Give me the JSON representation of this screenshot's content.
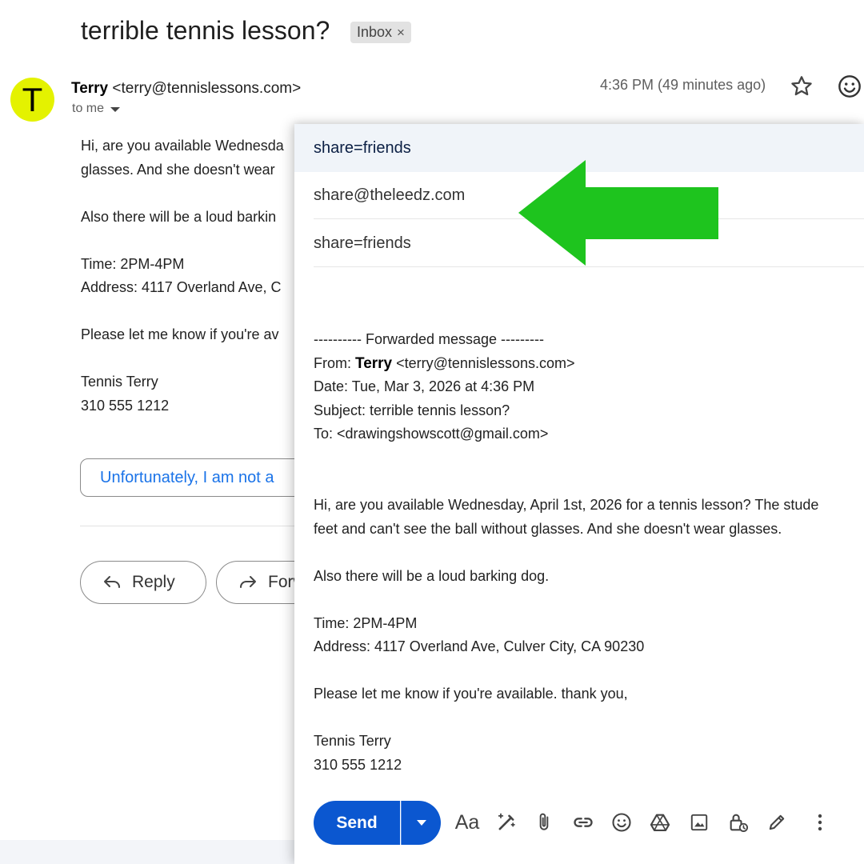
{
  "email": {
    "subject": "terrible tennis lesson?",
    "label_chip": "Inbox",
    "label_close": "×",
    "avatar_letter": "T",
    "sender_name": "Terry",
    "sender_email": "<terry@tennislessons.com>",
    "recipient": "to me",
    "timestamp": "4:36 PM (49 minutes ago)",
    "body_lines": [
      "Hi, are you available Wednesda",
      "glasses.  And she doesn't wear",
      "",
      "Also there will be a loud barkin",
      "",
      "Time: 2PM-4PM",
      "Address:  4117 Overland Ave, C",
      "",
      "Please let me know if you're av",
      "",
      "Tennis Terry",
      "310 555 1212"
    ],
    "smart_reply": "Unfortunately, I am not a",
    "reply_label": "Reply",
    "forward_label": "Forw"
  },
  "compose": {
    "header_title": "share=friends",
    "to_value": "share@theleedz.com",
    "subject_value": "share=friends",
    "forward_header": "---------- Forwarded message ---------",
    "from_label": "From: ",
    "from_name": "Terry",
    "from_email": " <terry@tennislessons.com>",
    "date_line": "Date: Tue, Mar 3, 2026 at 4:36 PM",
    "subject_line": "Subject: terrible tennis lesson?",
    "to_line": "To: <drawingshowscott@gmail.com>",
    "body_lines": [
      "Hi, are you available Wednesday, April 1st, 2026 for a tennis lesson? The stude",
      "feet and can't see the ball without glasses.  And she doesn't wear glasses.",
      "",
      "Also there will be a loud barking dog.",
      "",
      "Time: 2PM-4PM",
      "Address:  4117 Overland Ave, Culver City, CA 90230",
      "",
      "Please let me know if you're available.  thank you,",
      "",
      "Tennis Terry",
      "310 555 1212"
    ],
    "send_label": "Send",
    "format_label": "Aa"
  },
  "icons": {
    "star": "star-icon",
    "emoji": "smile-icon",
    "reply": "reply-arrow-icon",
    "forward": "forward-arrow-icon",
    "send_options": "chevron-down-icon",
    "toolbar": [
      "formatting-icon",
      "ai-write-icon",
      "attach-icon",
      "link-icon",
      "emoji-icon",
      "drive-icon",
      "photo-icon",
      "confidential-lock-icon",
      "signature-pen-icon",
      "more-options-icon"
    ]
  },
  "colors": {
    "avatar": "#e4f200",
    "send_button": "#0b57d0",
    "smart_reply_text": "#1a73e8",
    "annotation_arrow": "#1ec41e"
  }
}
